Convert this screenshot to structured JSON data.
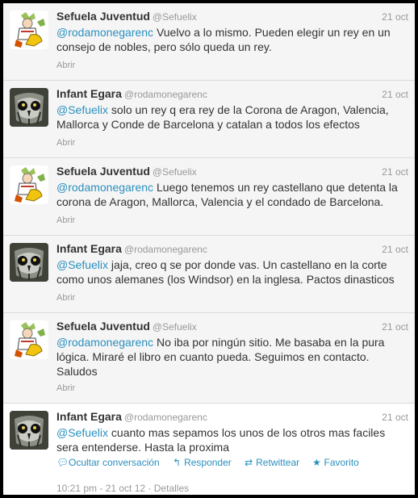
{
  "expand_label": "Abrir",
  "tweets": [
    {
      "fullname": "Sefuela Juventud",
      "username": "@Sefuelix",
      "time": "21 oct",
      "mention": "@rodamonegarenc",
      "body": " Vuelvo a lo mismo. Pueden elegir un rey en un consejo de nobles, pero sólo queda un rey."
    },
    {
      "fullname": "Infant Egara",
      "username": "@rodamonegarenc",
      "time": "21 oct",
      "mention": "@Sefuelix",
      "body": " solo un rey q era rey de la Corona de Aragon, Valencia, Mallorca y Conde de Barcelona y catalan a todos los efectos"
    },
    {
      "fullname": "Sefuela Juventud",
      "username": "@Sefuelix",
      "time": "21 oct",
      "mention": "@rodamonegarenc",
      "body": " Luego tenemos un rey castellano que detenta la corona de Aragon, Mallorca, Valencia y el condado de Barcelona."
    },
    {
      "fullname": "Infant Egara",
      "username": "@rodamonegarenc",
      "time": "21 oct",
      "mention": "@Sefuelix",
      "body": " jaja, creo q se por donde vas. Un castellano en la corte como unos alemanes (los Windsor) en la inglesa. Pactos dinasticos"
    },
    {
      "fullname": "Sefuela Juventud",
      "username": "@Sefuelix",
      "time": "21 oct",
      "mention": "@rodamonegarenc",
      "body": " No iba por ningún sitio. Me basaba en la pura lógica. Miraré el libro en cuanto pueda. Seguimos en contacto. Saludos"
    }
  ],
  "focused": {
    "fullname": "Infant Egara",
    "username": "@rodamonegarenc",
    "time": "21 oct",
    "mention": "@Sefuelix",
    "body": " cuanto mas sepamos los unos de los otros mas faciles sera entenderse. Hasta la proxima",
    "actions": {
      "hide": "Ocultar conversación",
      "reply": "Responder",
      "retweet": "Retwittear",
      "favorite": "Favorito"
    },
    "timestamp": "10:21 pm - 21 oct 12",
    "separator": "·",
    "details": "Detalles"
  },
  "colors": {
    "link": "#2a8fbd",
    "muted": "#999999",
    "text": "#333333",
    "row_bg": "#f5f5f5"
  }
}
